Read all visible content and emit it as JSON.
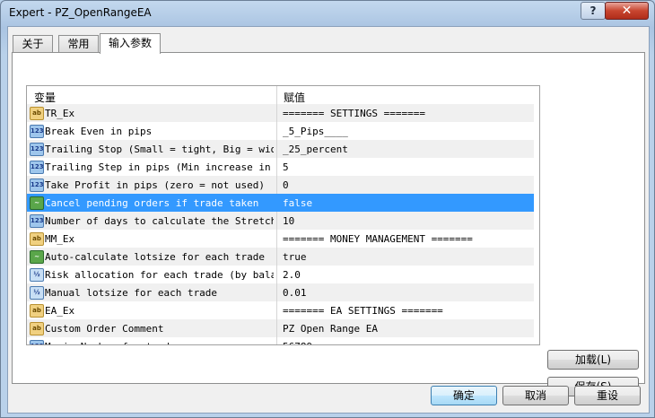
{
  "window": {
    "title": "Expert - PZ_OpenRangeEA",
    "help_label": "?",
    "close_label": "✕"
  },
  "tabs": [
    {
      "label": "关于"
    },
    {
      "label": "常用"
    },
    {
      "label": "输入参数",
      "active": true
    }
  ],
  "grid": {
    "columns": {
      "variable": "变量",
      "value": "赋值"
    },
    "rows": [
      {
        "icon": "string-icon",
        "icon_text": "ab",
        "variable": "TR_Ex",
        "value": "======= SETTINGS ======="
      },
      {
        "icon": "integer-icon",
        "icon_text": "123",
        "variable": "Break Even in pips",
        "value": "_5_Pips____"
      },
      {
        "icon": "integer-icon",
        "icon_text": "123",
        "variable": "Trailing Stop (Small = tight, Big = wide)",
        "value": "_25_percent"
      },
      {
        "icon": "integer-icon",
        "icon_text": "123",
        "variable": "Trailing Step in pips (Min increase in SL)",
        "value": "5"
      },
      {
        "icon": "integer-icon",
        "icon_text": "123",
        "variable": "Take Profit in pips (zero = not used)",
        "value": "0"
      },
      {
        "icon": "boolean-icon",
        "icon_text": "~",
        "variable": "Cancel pending orders if trade taken",
        "value": "false",
        "selected": true
      },
      {
        "icon": "integer-icon",
        "icon_text": "123",
        "variable": "Number of days to calculate the Stretch",
        "value": "10"
      },
      {
        "icon": "string-icon",
        "icon_text": "ab",
        "variable": "MM_Ex",
        "value": "======= MONEY MANAGEMENT ======="
      },
      {
        "icon": "boolean-icon",
        "icon_text": "~",
        "variable": "Auto-calculate lotsize for each trade",
        "value": "true"
      },
      {
        "icon": "double-icon",
        "icon_text": "½",
        "variable": "Risk allocation for each trade (by bala...",
        "value": "2.0"
      },
      {
        "icon": "double-icon",
        "icon_text": "½",
        "variable": "Manual lotsize for each trade",
        "value": "0.01"
      },
      {
        "icon": "string-icon",
        "icon_text": "ab",
        "variable": "EA_Ex",
        "value": "======= EA SETTINGS ======="
      },
      {
        "icon": "string-icon",
        "icon_text": "ab",
        "variable": "Custom Order Comment",
        "value": "PZ Open Range EA"
      },
      {
        "icon": "integer-icon",
        "icon_text": "123",
        "variable": "Magic Number for trades",
        "value": "56789"
      }
    ]
  },
  "buttons": {
    "load": "加载(L)",
    "save": "保存(S)",
    "ok": "确定",
    "cancel": "取消",
    "reset": "重设"
  }
}
